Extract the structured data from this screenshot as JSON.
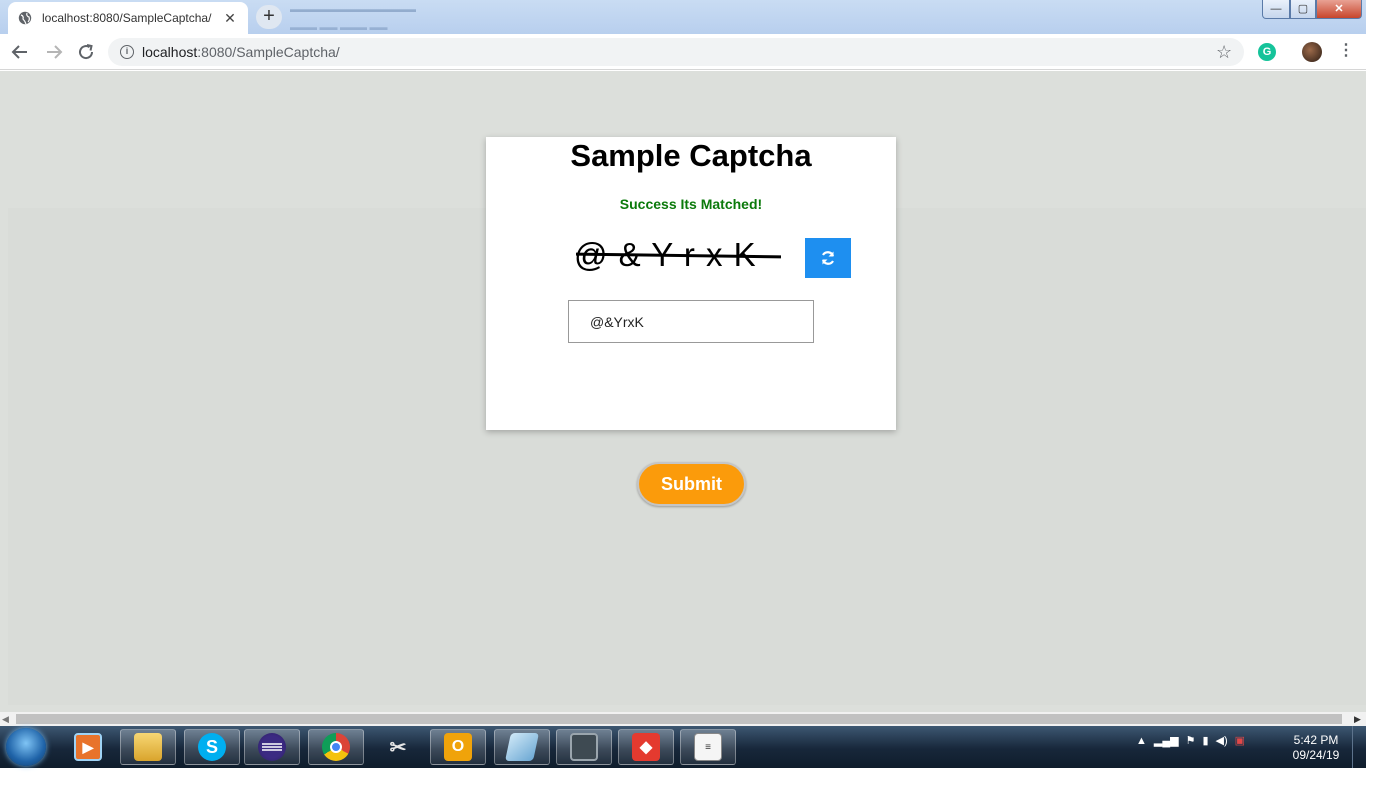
{
  "browser": {
    "tab_title": "localhost:8080/SampleCaptcha/",
    "tab_close": "✕",
    "new_tab": "+",
    "url_host": "localhost",
    "url_path": ":8080/SampleCaptcha/",
    "window_controls": {
      "minimize": "—",
      "maximize": "▢",
      "close": "✕"
    }
  },
  "page": {
    "heading": "Sample Captcha",
    "status": "Success Its Matched!",
    "status_color": "#0b7a0b",
    "captcha_text": "@ & Y r x K",
    "answer_value": "@&YrxK",
    "submit_label": "Submit",
    "refresh_icon": "refresh-icon",
    "accent": "#1e8ff0",
    "submit_color": "#fb9b0b"
  },
  "taskbar": {
    "apps": [
      "windows-media-player-icon",
      "file-explorer-icon",
      "skype-icon",
      "eclipse-icon",
      "chrome-icon",
      "tools-icon",
      "outlook-icon",
      "notes-icon",
      "monitor-icon",
      "git-icon",
      "notepad-icon"
    ],
    "skype_letter": "S",
    "outlook_letter": "O",
    "clock_time": "5:42 PM",
    "clock_date": "09/24/19"
  }
}
